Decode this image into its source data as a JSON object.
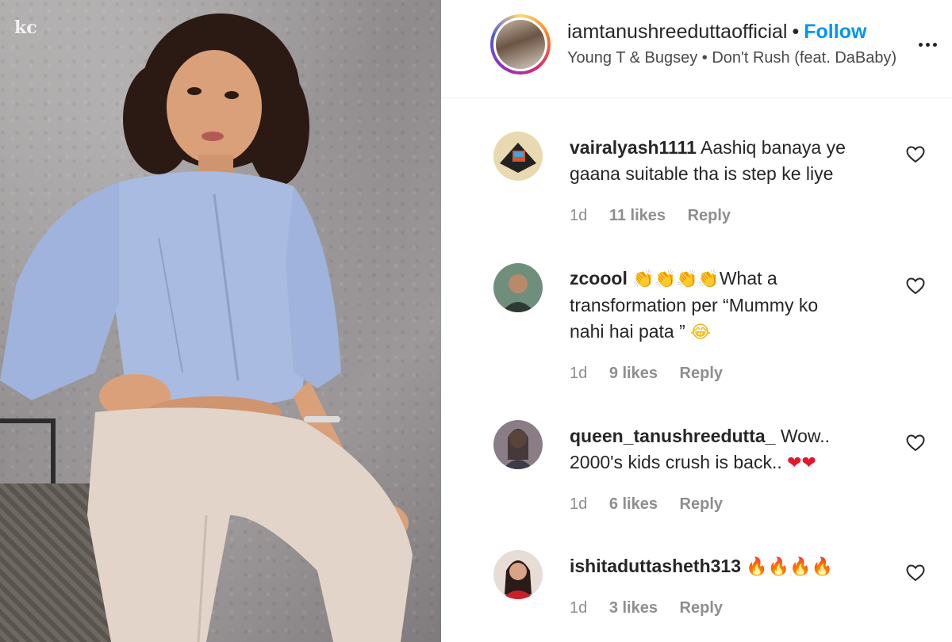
{
  "post": {
    "watermark": "kc",
    "author": {
      "username": "iamtanushreeduttaofficial",
      "separator": "•",
      "follow_label": "Follow",
      "audio": "Young T & Bugsey • Don't Rush (feat. DaBaby)"
    },
    "more_icon": "more-horizontal-icon"
  },
  "comments": [
    {
      "username": "vairalyash1111",
      "text_line1": "Aashiq banaya ye",
      "text_rest": "gaana suitable tha is step ke liye",
      "emoji": "",
      "time": "1d",
      "likes": "11 likes",
      "reply": "Reply"
    },
    {
      "username": "zcoool",
      "emoji_prefix": "👏👏👏👏",
      "text_line1": "What a",
      "text_line2": "transformation per “Mummy ko",
      "text_line3": "nahi hai pata ”",
      "emoji": "😂",
      "time": "1d",
      "likes": "9 likes",
      "reply": "Reply"
    },
    {
      "username": "queen_tanushreedutta_",
      "text_line1": "Wow..",
      "text_line2": "2000's kids crush is back..",
      "emoji": "❤❤",
      "time": "1d",
      "likes": "6 likes",
      "reply": "Reply"
    },
    {
      "username": "ishitaduttasheth313",
      "emoji": "🔥🔥🔥🔥",
      "time": "1d",
      "likes": "3 likes",
      "reply": "Reply"
    }
  ],
  "colors": {
    "follow": "#0095f6",
    "meta": "#8e8e8e",
    "text": "#262626"
  }
}
